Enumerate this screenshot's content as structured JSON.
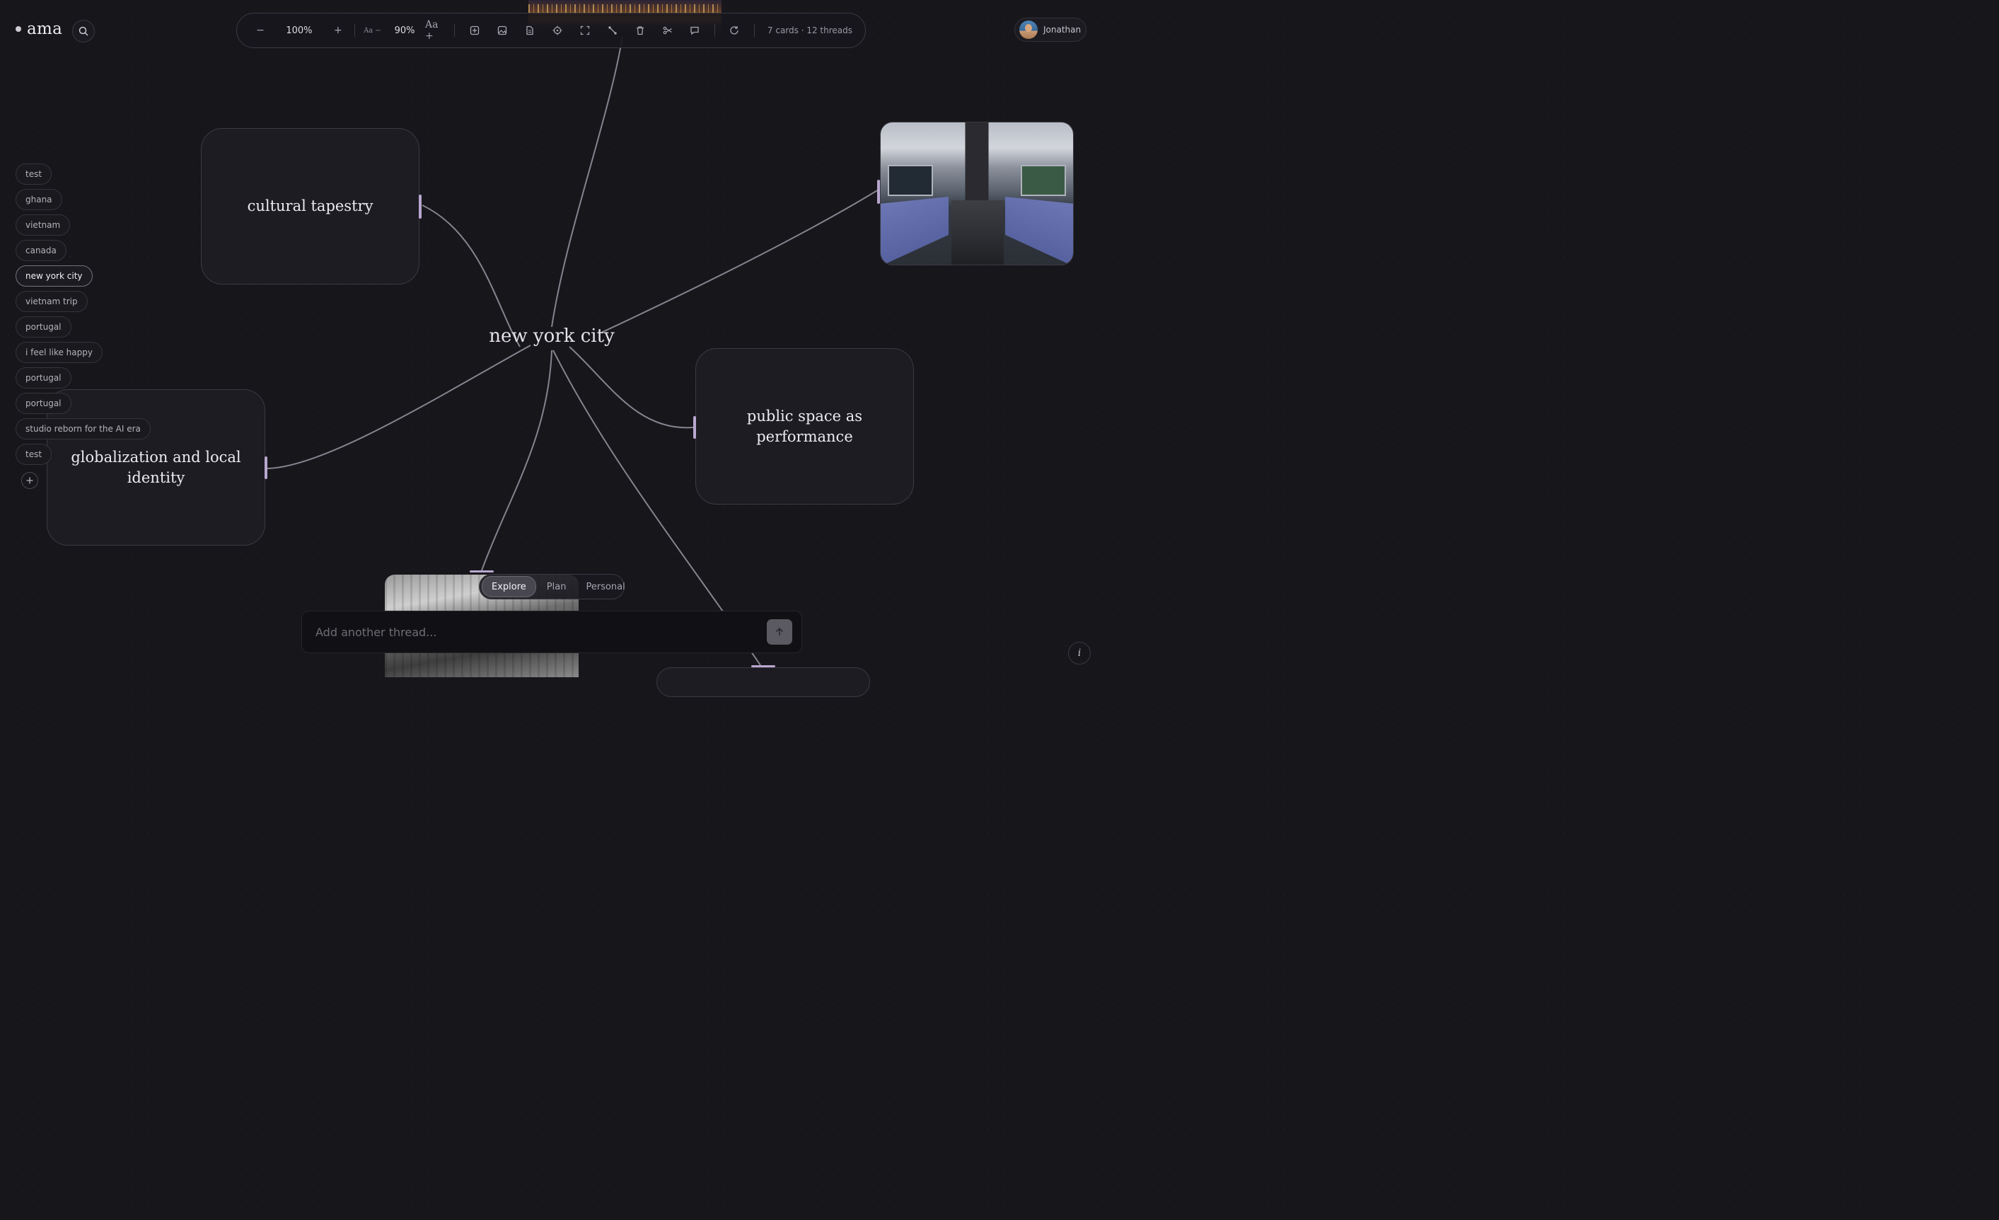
{
  "app": {
    "name": "ama"
  },
  "toolbar": {
    "zoom_out": "−",
    "zoom_value": "100%",
    "zoom_in": "+",
    "font_smaller": "Aa −",
    "font_value": "90%",
    "font_larger": "Aa +",
    "stats": "7 cards · 12 threads",
    "icons": [
      "add-card-icon",
      "add-image-icon",
      "add-document-icon",
      "locate-icon",
      "fit-screen-icon",
      "connect-icon",
      "delete-icon",
      "branch-icon",
      "comment-icon",
      "refresh-icon"
    ]
  },
  "user": {
    "name": "Jonathan"
  },
  "threads": [
    {
      "label": "test",
      "active": false
    },
    {
      "label": "ghana",
      "active": false
    },
    {
      "label": "vietnam",
      "active": false
    },
    {
      "label": "canada",
      "active": false
    },
    {
      "label": "new york city",
      "active": true
    },
    {
      "label": "vietnam trip",
      "active": false
    },
    {
      "label": "portugal",
      "active": false
    },
    {
      "label": "i feel like happy",
      "active": false
    },
    {
      "label": "portugal",
      "active": false
    },
    {
      "label": "portugal",
      "active": false
    },
    {
      "label": "studio reborn for the AI era",
      "active": false
    },
    {
      "label": "test",
      "active": false
    }
  ],
  "canvas": {
    "center_topic": "new york city",
    "cards": {
      "cultural": "cultural tapestry",
      "globalization": "globalization and local identity",
      "public_space": "public space as performance"
    }
  },
  "modes": [
    {
      "label": "Explore",
      "active": true
    },
    {
      "label": "Plan",
      "active": false
    },
    {
      "label": "Personal",
      "active": false
    }
  ],
  "composer": {
    "placeholder": "Add another thread..."
  },
  "info": {
    "label": "i"
  },
  "colors": {
    "background": "#17161b",
    "edge": "#8a8792",
    "handle": "#b9a7cf",
    "accent_active_chip": "#75737d"
  }
}
